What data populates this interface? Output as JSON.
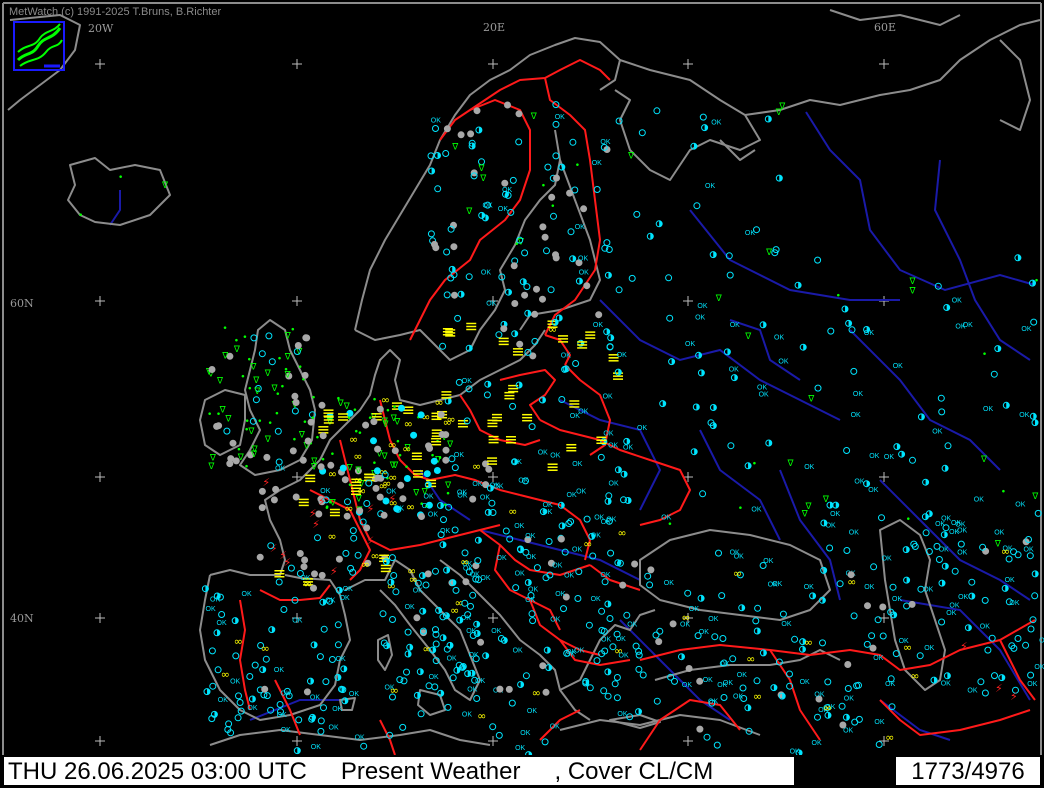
{
  "header": {
    "credit": "MetWatch  (c) 1991-2025 T.Bruns, B.Richter"
  },
  "grid_labels": {
    "lon_20w": "20W",
    "lon_20e": "20E",
    "lon_60e": "60E",
    "lat_60n": "60N",
    "lat_40n": "40N"
  },
  "status": {
    "datetime": "THU 26.06.2025 03:00 UTC",
    "product": "Present Weather",
    "secondary": ", Cover CL/CM",
    "station_count": "1773/4976"
  },
  "colors": {
    "background": "#000000",
    "coastline": "#8c8c8c",
    "borders": "#ff1a1a",
    "rivers": "#1a1aa8",
    "station_clear": "#00e5ff",
    "station_cloud": "#a8a8a8",
    "rain": "#00ff00",
    "fog_haze": "#ffff00",
    "thunderstorm": "#ff2020",
    "status_bar": "#ffffff"
  },
  "symbols": {
    "ok_label": "OK"
  }
}
